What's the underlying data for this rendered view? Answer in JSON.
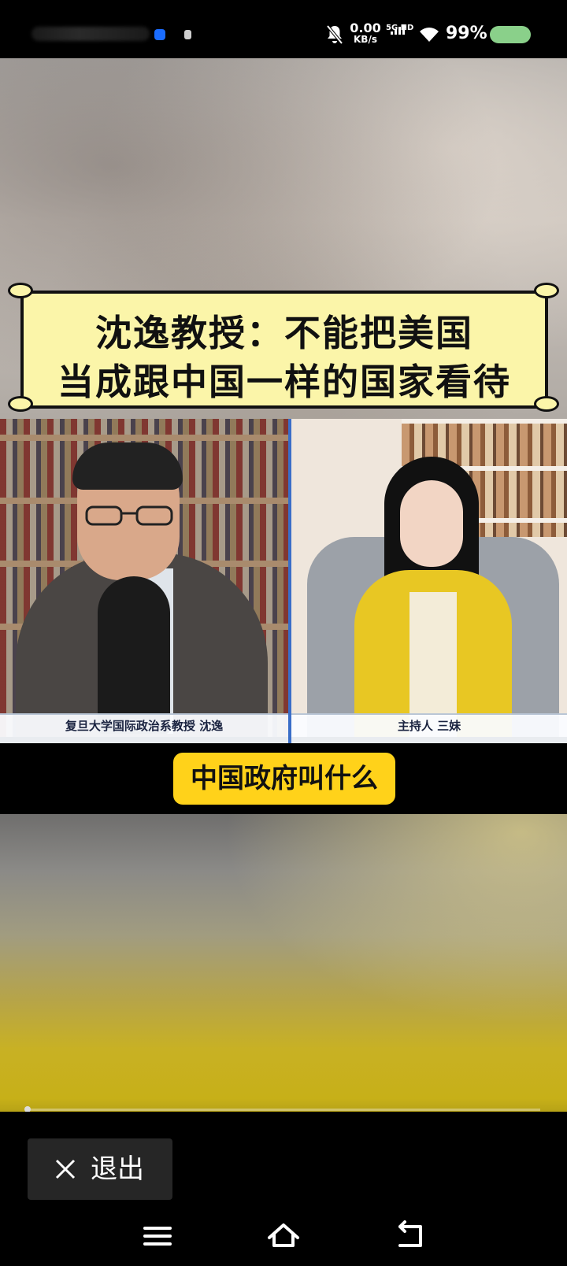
{
  "status_bar": {
    "net_speed_value": "0.00",
    "net_speed_unit": "KB/s",
    "network_type": "5G HD",
    "battery_percent": "99%",
    "battery_color": "#8ad08a",
    "icons": [
      "notification-dot-icon",
      "mute-icon",
      "signal-icon",
      "wifi-icon",
      "battery-icon"
    ]
  },
  "video": {
    "title_line1": "沈逸教授：不能把美国",
    "title_line2": "当成跟中国一样的国家看待",
    "left_caption": "复旦大学国际政治系教授 沈逸",
    "right_caption": "主持人 三妹",
    "subtitle": "中国政府叫什么",
    "accent_yellow": "#ffd21a",
    "banner_color": "#fbf5a9",
    "progress": 0.0
  },
  "controls": {
    "exit_label": "退出"
  },
  "nav": {
    "icons": [
      "menu-icon",
      "home-icon",
      "back-icon"
    ]
  }
}
